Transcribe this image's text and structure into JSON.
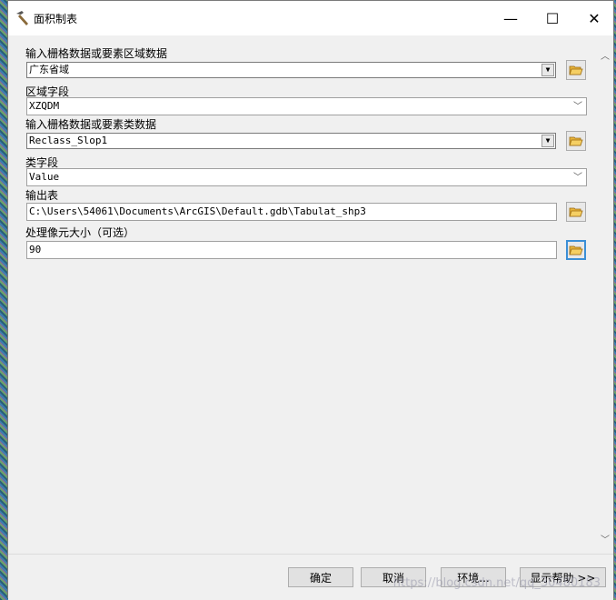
{
  "window": {
    "title": "面积制表"
  },
  "titlebar": {
    "minimize": "—",
    "maximize": "☐",
    "close": "✕"
  },
  "form": {
    "input_raster_zone_label": "输入栅格数据或要素区域数据",
    "input_raster_zone_value": "广东省域",
    "zone_field_label": "区域字段",
    "zone_field_value": "XZQDM",
    "input_raster_class_label": "输入栅格数据或要素类数据",
    "input_raster_class_value": "Reclass_Slop1",
    "class_field_label": "类字段",
    "class_field_value": "Value",
    "output_table_label": "输出表",
    "output_table_value": "C:\\Users\\54061\\Documents\\ArcGIS\\Default.gdb\\Tabulat_shp3",
    "cell_size_label": "处理像元大小（可选）",
    "cell_size_value": "90"
  },
  "buttons": {
    "ok": "确定",
    "cancel": "取消",
    "environments": "环境...",
    "show_help": "显示帮助 >>"
  },
  "watermark": "https://blog.csdn.net/qq_30480183",
  "colors": {
    "focus": "#3c8fd6",
    "folder": "#e8b43a"
  }
}
